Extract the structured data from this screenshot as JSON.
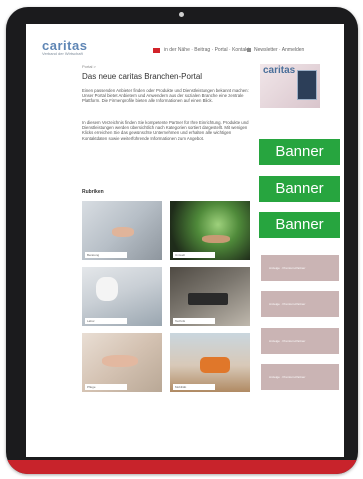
{
  "header": {
    "logo": "caritas",
    "logo_subtitle": "Verband der Wirtschaft",
    "nav_item_1": "in der Nähe · Beitrag · Portal · Kontakt",
    "nav_item_2": "Newsletter · Anmelden"
  },
  "main": {
    "breadcrumb": "Portal >",
    "title": "Das neue caritas Branchen-Portal",
    "paragraph_1": "Einen passenden Anbieter finden oder Produkte und Dienstleistungen bekannt machen: Unser Portal bietet Anbietern und Anwendern aus der sozialen Branche eine zentrale Plattform. Die Firmenprofile bieten alle Informationen auf einen Blick.",
    "paragraph_2": "In diesem Verzeichnis finden Sie kompetente Partner für Ihre Einrichtung. Produkte und Dienstleistungen werden übersichtlich nach Kategorien sortiert dargestellt. Mit wenigen Klicks erreichen Sie das gewünschte Unternehmen und erhalten alle wichtigen Kontaktdaten sowie weiterführende Informationen zum Angebot.",
    "section_label": "Rubriken",
    "photos": [
      {
        "caption": "Beratung"
      },
      {
        "caption": "Umwelt"
      },
      {
        "caption": "Labor"
      },
      {
        "caption": "Technik"
      },
      {
        "caption": "Pflege"
      },
      {
        "caption": "Mobilität"
      }
    ]
  },
  "sidebar": {
    "magazine_logo": "caritas",
    "banners": [
      "Banner",
      "Banner",
      "Banner"
    ],
    "ad_boxes": [
      "Anzeige · Premium-Partner",
      "Anzeige · Premium-Partner",
      "Anzeige · Premium-Partner",
      "Anzeige · Premium-Partner"
    ]
  },
  "colors": {
    "banner_green": "#27a53f",
    "frame_red": "#c8232b",
    "logo_blue": "#5f86b5",
    "ad_box": "#cab4b4"
  }
}
